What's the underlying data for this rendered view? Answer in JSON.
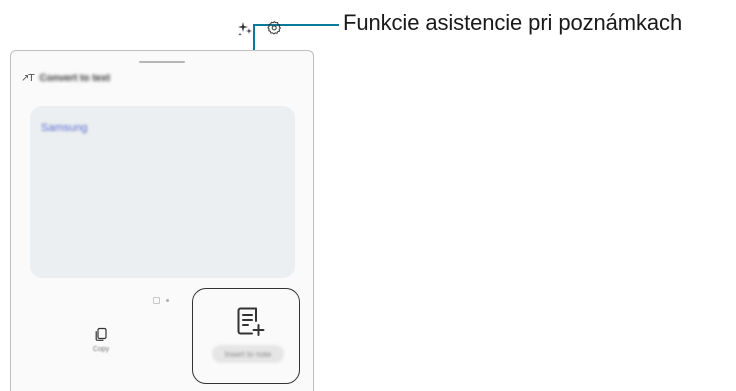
{
  "callout": {
    "label": "Funkcie asistencie pri poznámkach"
  },
  "header": {
    "title": "Convert to text",
    "title_icon": "text-tt-icon",
    "ai_icon": "sparkle-icon",
    "settings_icon": "gear-icon"
  },
  "main": {
    "recognized_text": "Samsung"
  },
  "pager": {
    "count": 2,
    "current": 1
  },
  "bottom": {
    "copy": {
      "icon": "copy-icon",
      "label": "Copy"
    },
    "insert": {
      "icon": "note-add-icon",
      "label": "Insert to note"
    }
  },
  "colors": {
    "callout_line": "#0b7a9a",
    "card_background": "#eceff1",
    "recognized_text": "#5a6fd0"
  }
}
